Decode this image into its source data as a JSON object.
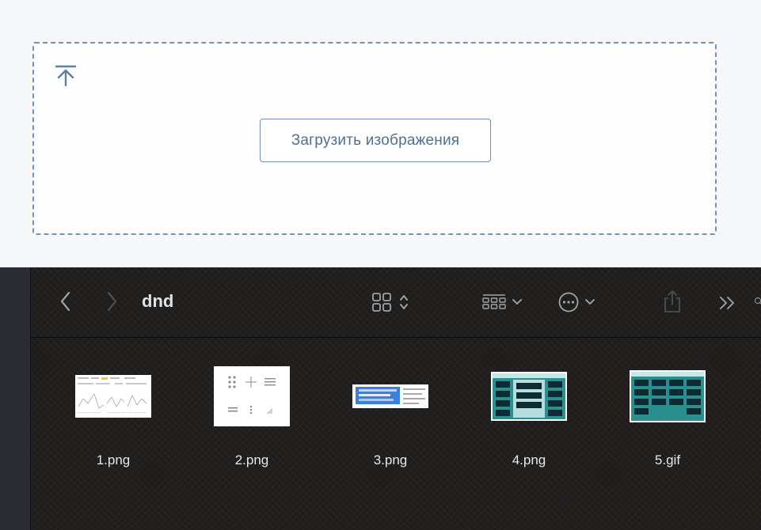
{
  "upload": {
    "button_label": "Загрузить изображения",
    "icon": "upload-arrow-icon",
    "accent_color": "#5a7fa8"
  },
  "finder": {
    "folder_title": "dnd",
    "toolbar": {
      "back_icon": "chevron-left-icon",
      "forward_icon": "chevron-right-icon",
      "view_icon": "grid-view-icon",
      "group_icon": "group-by-icon",
      "action_icon": "more-actions-icon",
      "share_icon": "share-icon",
      "overflow_icon": "double-chevron-right-icon",
      "search_icon": "search-icon"
    },
    "files": [
      {
        "name": "1.png"
      },
      {
        "name": "2.png"
      },
      {
        "name": "3.png"
      },
      {
        "name": "4.png"
      },
      {
        "name": "5.gif"
      }
    ]
  }
}
